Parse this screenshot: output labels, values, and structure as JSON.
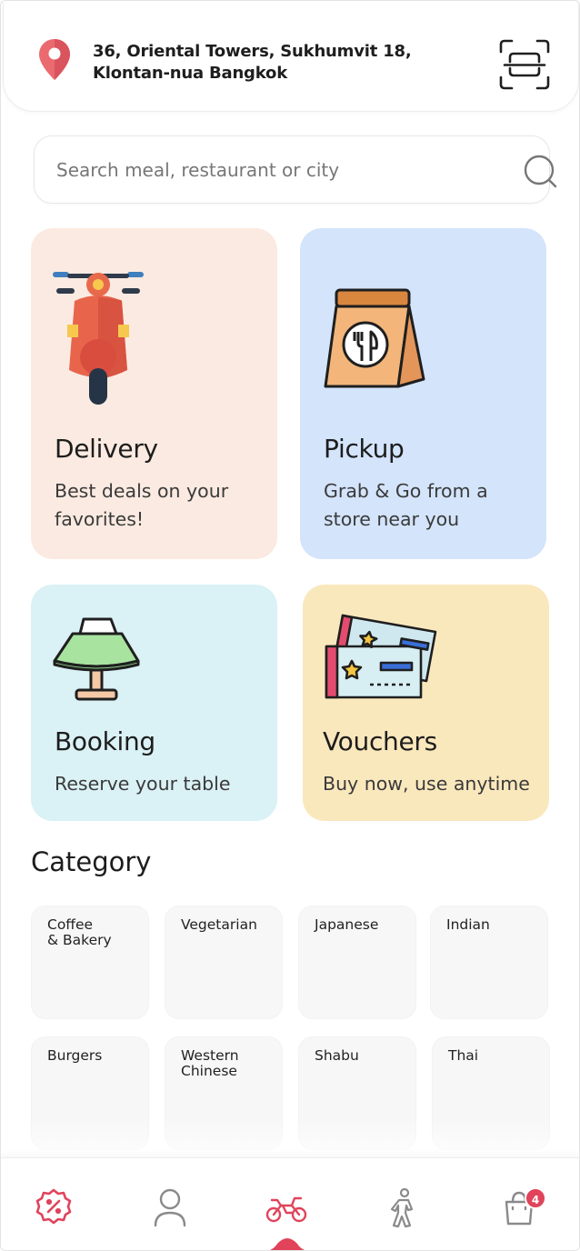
{
  "header": {
    "address_line1": "36, Oriental Towers, Sukhumvit 18,",
    "address_line2": "Klontan-nua Bangkok",
    "location_icon": "map-pin-icon",
    "scan_icon": "scan-icon"
  },
  "search": {
    "placeholder": "Search meal, restaurant or city",
    "icon": "search-icon"
  },
  "services": [
    {
      "title": "Delivery",
      "subtitle_line1": "Best deals on your",
      "subtitle_line2": "favorites!",
      "icon": "scooter-icon",
      "color": "#fbeae1"
    },
    {
      "title": "Pickup",
      "subtitle_line1": "Grab & Go from a",
      "subtitle_line2": "store near you",
      "icon": "takeaway-bag-icon",
      "color": "#d3e4fb"
    },
    {
      "title": "Booking",
      "subtitle_line1": "Reserve your table",
      "icon": "reserved-table-icon",
      "color": "#daf1f5"
    },
    {
      "title": "Vouchers",
      "subtitle_line1": "Buy now, use anytime",
      "icon": "ticket-icon",
      "color": "#fae8bd"
    }
  ],
  "category": {
    "title": "Category",
    "items": [
      {
        "label": "Coffee\n& Bakery"
      },
      {
        "label": "Vegetarian"
      },
      {
        "label": "Japanese"
      },
      {
        "label": "Indian"
      },
      {
        "label": "Burgers"
      },
      {
        "label": "Western\nChinese"
      },
      {
        "label": "Shabu"
      },
      {
        "label": "Thai"
      }
    ]
  },
  "nav": {
    "items": [
      {
        "icon": "discount-badge-icon",
        "active": false
      },
      {
        "icon": "profile-icon",
        "active": false
      },
      {
        "icon": "motorbike-icon",
        "active": true
      },
      {
        "icon": "walking-person-icon",
        "active": false
      },
      {
        "icon": "shopping-bag-icon",
        "active": false
      }
    ],
    "cart_count": "4"
  },
  "colors": {
    "accent": "#e0435a",
    "pin": "#ea6a6f"
  }
}
